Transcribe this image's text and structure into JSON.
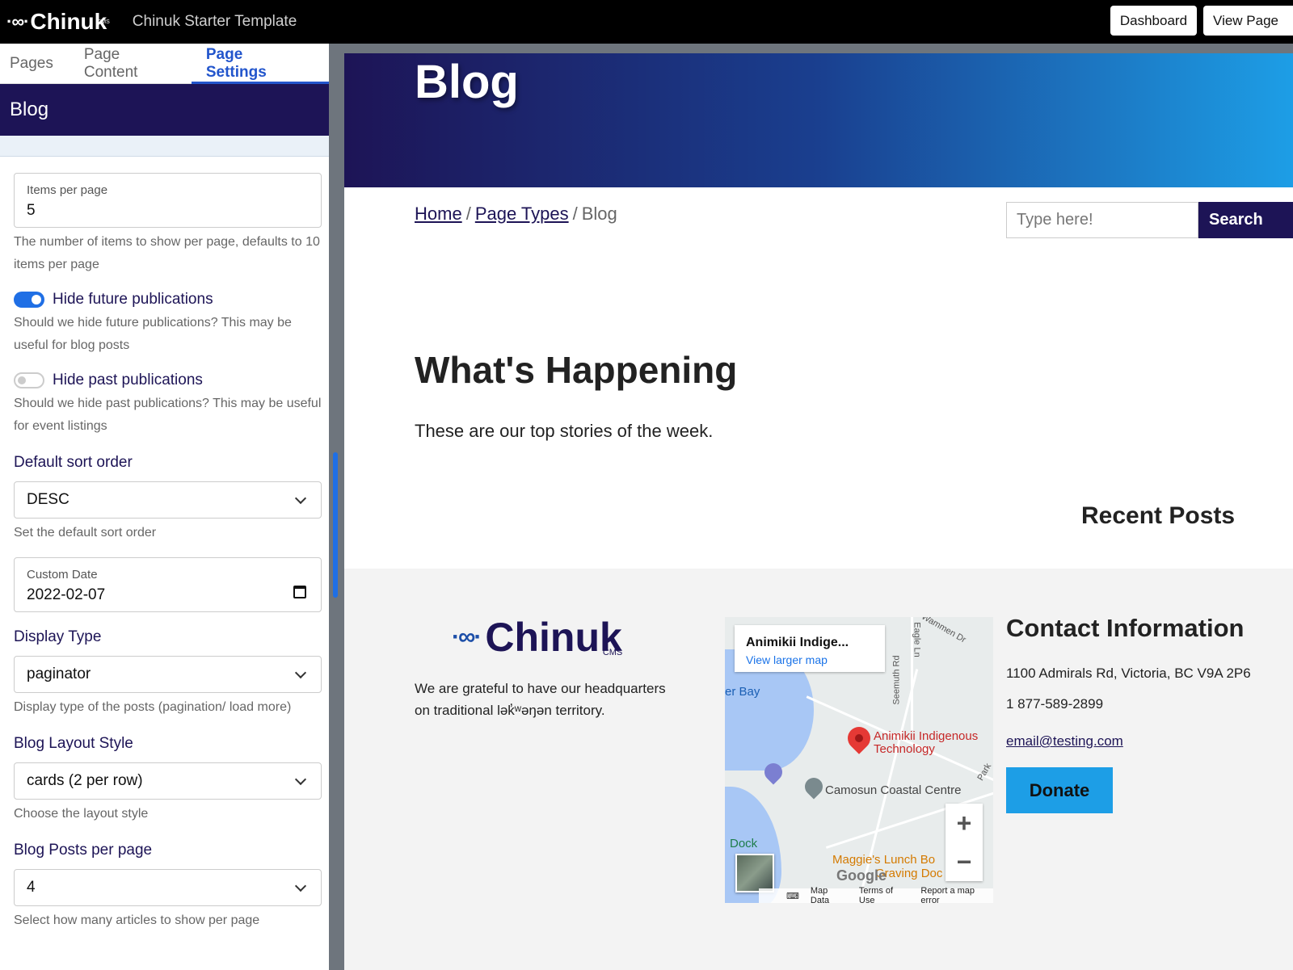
{
  "app": {
    "logo_text": "Chinuk",
    "logo_sub": "CMS",
    "title": "Chinuk Starter Template",
    "actions": [
      "Dashboard",
      "View Page"
    ]
  },
  "sidebar": {
    "tabs": [
      {
        "label": "Pages",
        "active": false
      },
      {
        "label": "Page Content",
        "active": false
      },
      {
        "label": "Page Settings",
        "active": true
      }
    ],
    "panel_title": "Blog",
    "items_per_page": {
      "label": "Items per page",
      "value": "5",
      "help": "The number of items to show per page, defaults to 10 items per page"
    },
    "hide_future": {
      "label": "Hide future publications",
      "on": true,
      "help": "Should we hide future publications? This may be useful for blog posts"
    },
    "hide_past": {
      "label": "Hide past publications",
      "on": false,
      "help": "Should we hide past publications? This may be useful for event listings"
    },
    "sort_order": {
      "label": "Default sort order",
      "value": "DESC",
      "help": "Set the default sort order"
    },
    "custom_date": {
      "label": "Custom Date",
      "value": "2022-02-07"
    },
    "display_type": {
      "label": "Display Type",
      "value": "paginator",
      "help": "Display type of the posts (pagination/ load more)"
    },
    "layout_style": {
      "label": "Blog Layout Style",
      "value": "cards (2 per row)",
      "help": "Choose the layout style"
    },
    "posts_per_page": {
      "label": "Blog Posts per page",
      "value": "4",
      "help": "Select how many articles to show per page"
    }
  },
  "preview": {
    "hero_title": "Blog",
    "breadcrumb": [
      "Home",
      "Page Types",
      "Blog"
    ],
    "search": {
      "placeholder": "Type here!",
      "button": "Search"
    },
    "heading": "What's Happening",
    "lead": "These are our top stories of the week.",
    "recent_posts": "Recent Posts",
    "footer": {
      "logo_text": "Chinuk",
      "logo_sub": "CMS",
      "acknowledgement": "We are grateful to have our headquarters on traditional lək̓ʷəŋən territory.",
      "map": {
        "place": "Animikii Indige...",
        "link": "View larger map",
        "pin_label": "Animikii Indigenous Technology",
        "labels": [
          "er Bay",
          "Camosun Coastal Centre",
          "Dock",
          "Maggie's Lunch Bo",
          "Graving Doc",
          "Seemuth Rd",
          "Eagle Ln",
          "Wammen Dr",
          "Park"
        ],
        "google": "Google",
        "footer": [
          "Map Data",
          "Terms of Use",
          "Report a map error"
        ]
      },
      "contact_title": "Contact Information",
      "address": "1100 Admirals Rd, Victoria, BC V9A 2P6",
      "phone": "1 877-589-2899",
      "email": "email@testing.com",
      "donate": "Donate"
    }
  }
}
